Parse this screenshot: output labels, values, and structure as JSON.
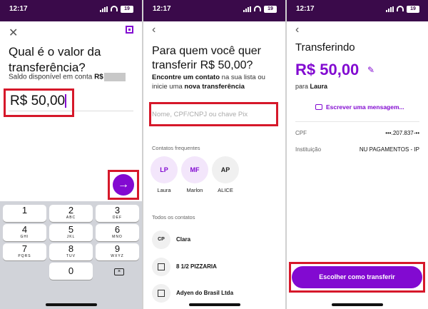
{
  "status": {
    "time": "12:17",
    "battery": "19"
  },
  "screen1": {
    "title": "Qual é o valor da transferência?",
    "balance_label": "Saldo disponível em conta",
    "balance_currency": "R$",
    "amount": "R$ 50,00",
    "keys": [
      {
        "d": "1",
        "l": ""
      },
      {
        "d": "2",
        "l": "ABC"
      },
      {
        "d": "3",
        "l": "DEF"
      },
      {
        "d": "4",
        "l": "GHI"
      },
      {
        "d": "5",
        "l": "JKL"
      },
      {
        "d": "6",
        "l": "MNO"
      },
      {
        "d": "7",
        "l": "PQRS"
      },
      {
        "d": "8",
        "l": "TUV"
      },
      {
        "d": "9",
        "l": "WXYZ"
      },
      {
        "d": "0",
        "l": ""
      }
    ]
  },
  "screen2": {
    "title": "Para quem você quer transferir R$ 50,00?",
    "subtitle_p1": "Encontre um contato",
    "subtitle_p2": " na sua lista ou inicie uma ",
    "subtitle_p3": "nova transferência",
    "search_placeholder": "Nome, CPF/CNPJ ou chave Pix",
    "frequent_header": "Contatos frequentes",
    "frequent": [
      {
        "initials": "LP",
        "name": "Laura"
      },
      {
        "initials": "MF",
        "name": "Marlon"
      },
      {
        "initials": "AP",
        "name": "ALICE"
      }
    ],
    "all_header": "Todos os contatos",
    "contacts": [
      {
        "initials": "CP",
        "name": "Clara"
      },
      {
        "initials": "",
        "name": "8 1/2 PIZZARIA"
      },
      {
        "initials": "",
        "name": "Adyen do Brasil Ltda"
      }
    ]
  },
  "screen3": {
    "title": "Transferindo",
    "amount": "R$ 50,00",
    "to_prefix": "para",
    "to_name": "Laura",
    "message_link": "Escrever uma mensagem...",
    "cpf_label": "CPF",
    "cpf_value": "•••.207.837-••",
    "inst_label": "Instituição",
    "inst_value": "NU PAGAMENTOS - IP",
    "cta": "Escolher como transferir"
  },
  "colors": {
    "accent": "#820ad1",
    "highlight": "#d6182a",
    "statusbar": "#3a0a4a"
  }
}
